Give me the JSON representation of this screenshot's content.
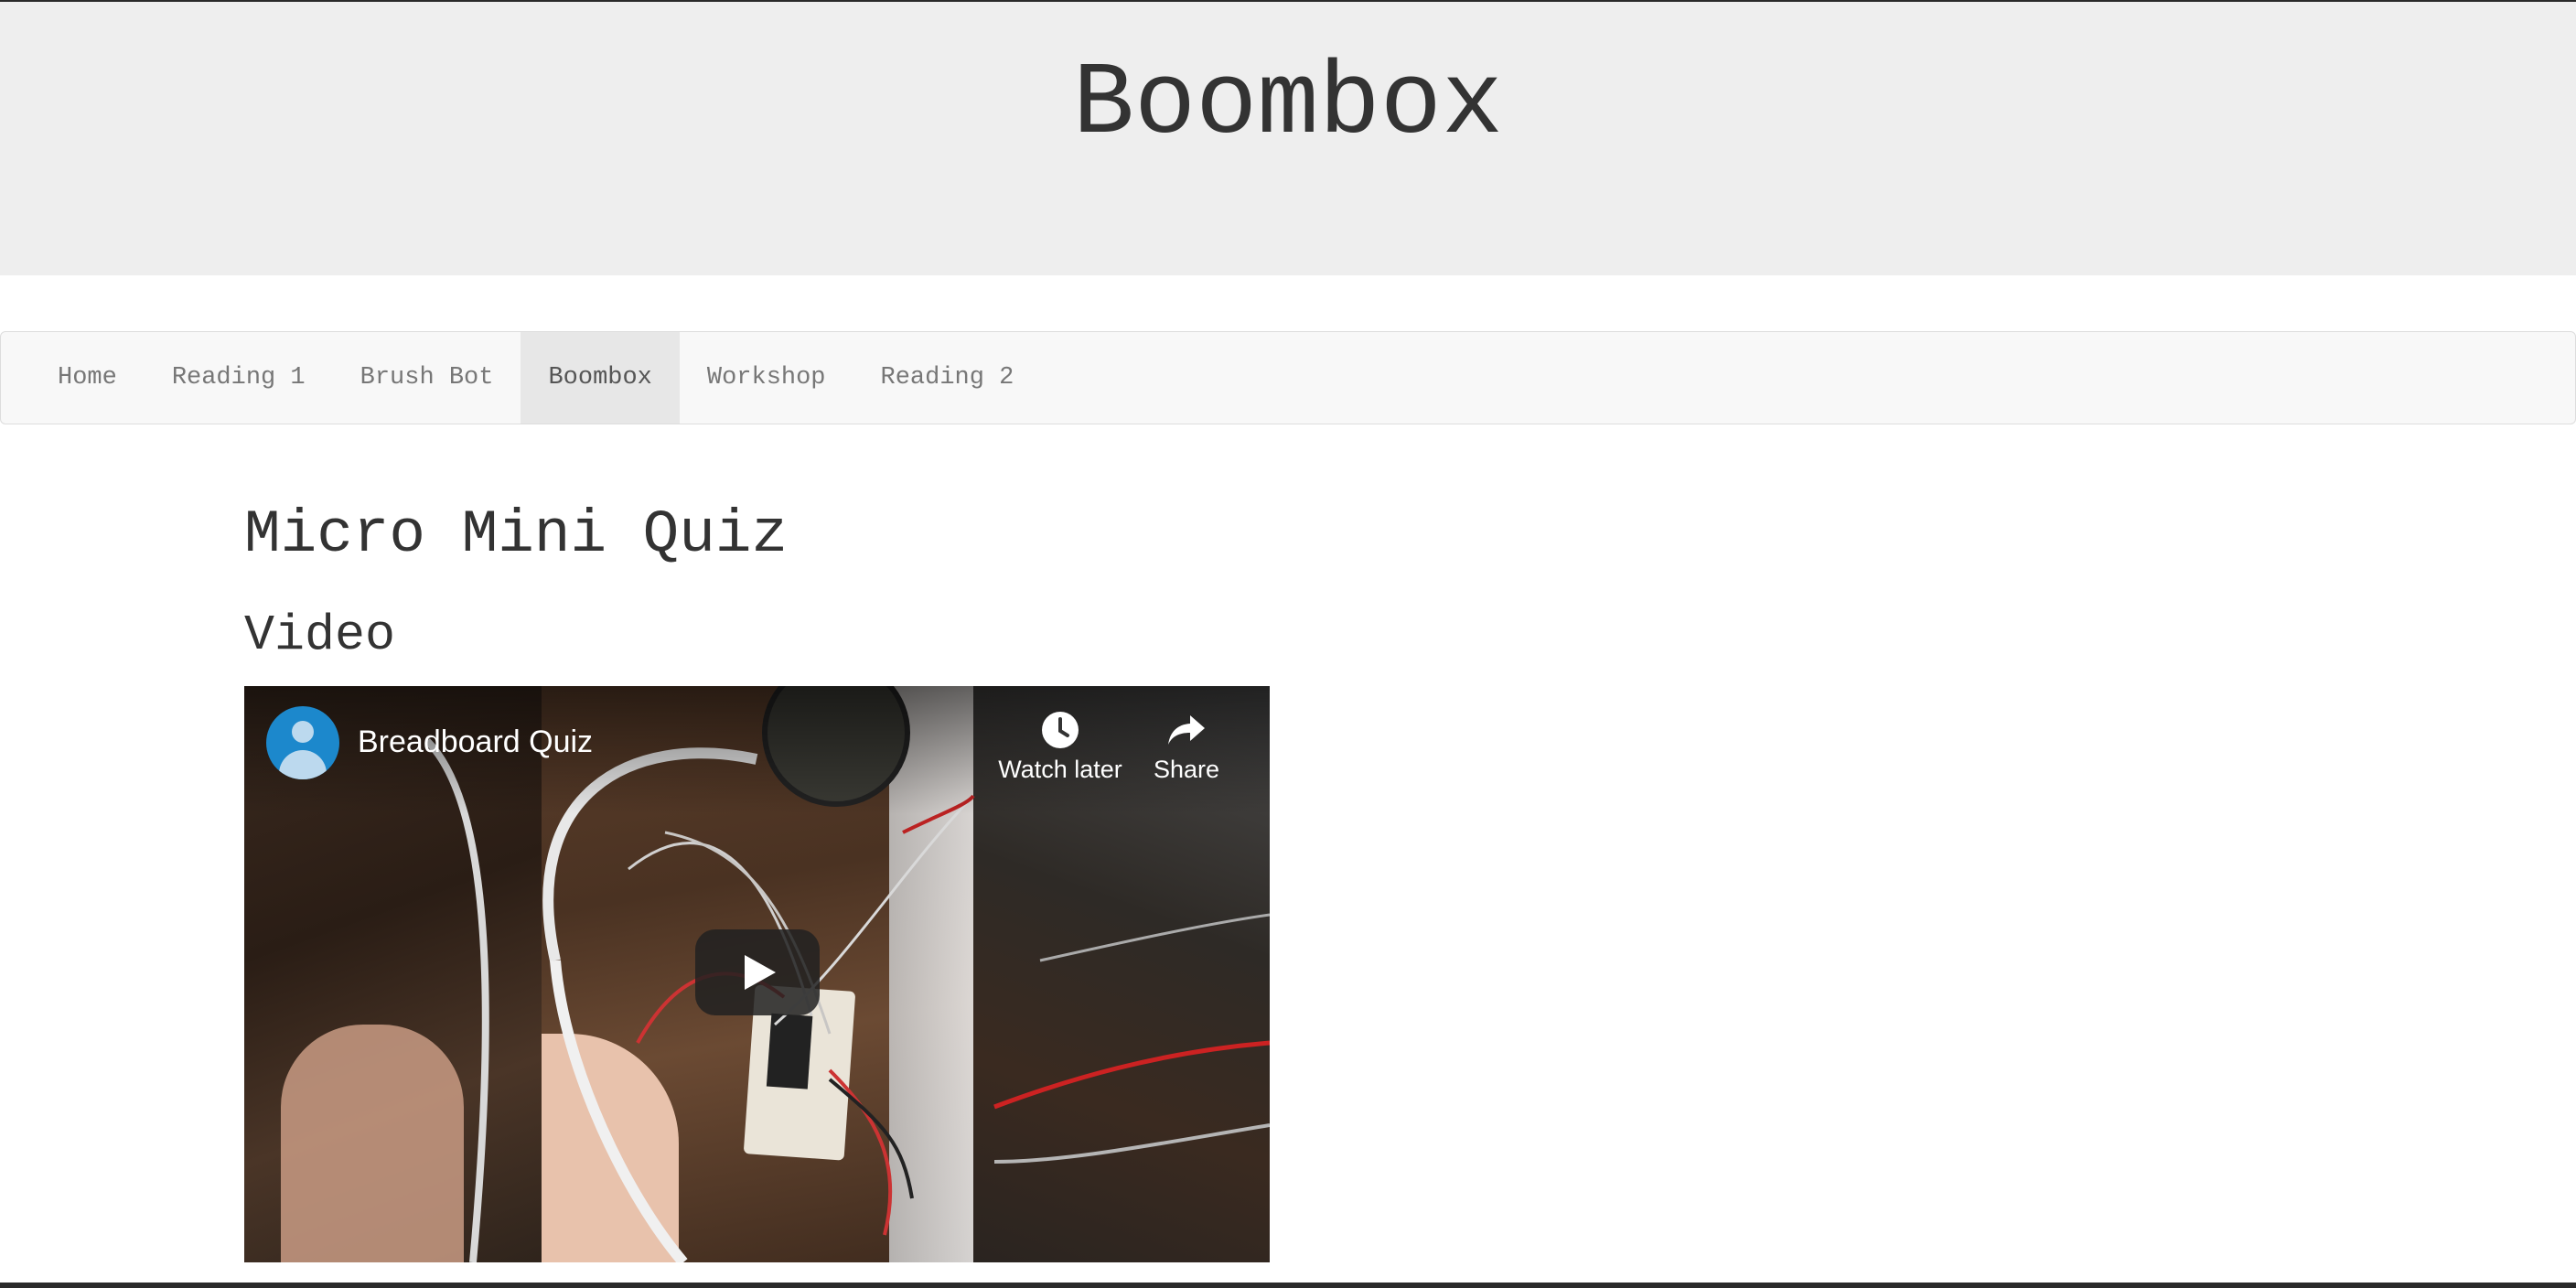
{
  "site": {
    "title": "Boombox"
  },
  "nav": {
    "items": [
      {
        "label": "Home",
        "active": false
      },
      {
        "label": "Reading 1",
        "active": false
      },
      {
        "label": "Brush Bot",
        "active": false
      },
      {
        "label": "Boombox",
        "active": true
      },
      {
        "label": "Workshop",
        "active": false
      },
      {
        "label": "Reading 2",
        "active": false
      }
    ]
  },
  "main": {
    "heading": "Micro Mini Quiz",
    "section_heading": "Video"
  },
  "video": {
    "title": "Breadboard Quiz",
    "watch_later_label": "Watch later",
    "share_label": "Share",
    "avatar_color": "#1c88cc"
  },
  "colors": {
    "header_bg": "#eeeeee",
    "navbar_bg": "#f8f8f8",
    "nav_active_bg": "#e7e7e7"
  }
}
